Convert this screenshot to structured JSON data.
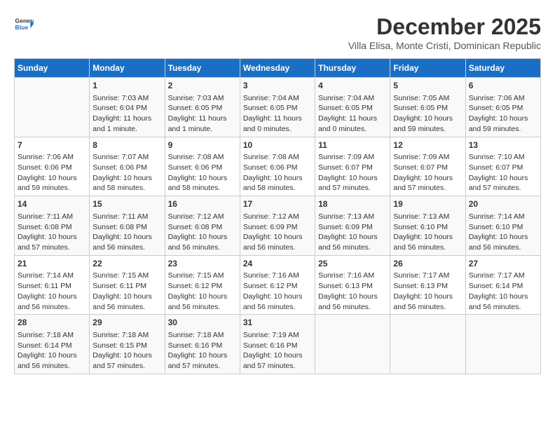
{
  "header": {
    "logo_line1": "General",
    "logo_line2": "Blue",
    "month": "December 2025",
    "location": "Villa Elisa, Monte Cristi, Dominican Republic"
  },
  "weekdays": [
    "Sunday",
    "Monday",
    "Tuesday",
    "Wednesday",
    "Thursday",
    "Friday",
    "Saturday"
  ],
  "weeks": [
    [
      {
        "num": "",
        "lines": []
      },
      {
        "num": "1",
        "lines": [
          "Sunrise: 7:03 AM",
          "Sunset: 6:04 PM",
          "Daylight: 11 hours",
          "and 1 minute."
        ]
      },
      {
        "num": "2",
        "lines": [
          "Sunrise: 7:03 AM",
          "Sunset: 6:05 PM",
          "Daylight: 11 hours",
          "and 1 minute."
        ]
      },
      {
        "num": "3",
        "lines": [
          "Sunrise: 7:04 AM",
          "Sunset: 6:05 PM",
          "Daylight: 11 hours",
          "and 0 minutes."
        ]
      },
      {
        "num": "4",
        "lines": [
          "Sunrise: 7:04 AM",
          "Sunset: 6:05 PM",
          "Daylight: 11 hours",
          "and 0 minutes."
        ]
      },
      {
        "num": "5",
        "lines": [
          "Sunrise: 7:05 AM",
          "Sunset: 6:05 PM",
          "Daylight: 10 hours",
          "and 59 minutes."
        ]
      },
      {
        "num": "6",
        "lines": [
          "Sunrise: 7:06 AM",
          "Sunset: 6:05 PM",
          "Daylight: 10 hours",
          "and 59 minutes."
        ]
      }
    ],
    [
      {
        "num": "7",
        "lines": [
          "Sunrise: 7:06 AM",
          "Sunset: 6:06 PM",
          "Daylight: 10 hours",
          "and 59 minutes."
        ]
      },
      {
        "num": "8",
        "lines": [
          "Sunrise: 7:07 AM",
          "Sunset: 6:06 PM",
          "Daylight: 10 hours",
          "and 58 minutes."
        ]
      },
      {
        "num": "9",
        "lines": [
          "Sunrise: 7:08 AM",
          "Sunset: 6:06 PM",
          "Daylight: 10 hours",
          "and 58 minutes."
        ]
      },
      {
        "num": "10",
        "lines": [
          "Sunrise: 7:08 AM",
          "Sunset: 6:06 PM",
          "Daylight: 10 hours",
          "and 58 minutes."
        ]
      },
      {
        "num": "11",
        "lines": [
          "Sunrise: 7:09 AM",
          "Sunset: 6:07 PM",
          "Daylight: 10 hours",
          "and 57 minutes."
        ]
      },
      {
        "num": "12",
        "lines": [
          "Sunrise: 7:09 AM",
          "Sunset: 6:07 PM",
          "Daylight: 10 hours",
          "and 57 minutes."
        ]
      },
      {
        "num": "13",
        "lines": [
          "Sunrise: 7:10 AM",
          "Sunset: 6:07 PM",
          "Daylight: 10 hours",
          "and 57 minutes."
        ]
      }
    ],
    [
      {
        "num": "14",
        "lines": [
          "Sunrise: 7:11 AM",
          "Sunset: 6:08 PM",
          "Daylight: 10 hours",
          "and 57 minutes."
        ]
      },
      {
        "num": "15",
        "lines": [
          "Sunrise: 7:11 AM",
          "Sunset: 6:08 PM",
          "Daylight: 10 hours",
          "and 56 minutes."
        ]
      },
      {
        "num": "16",
        "lines": [
          "Sunrise: 7:12 AM",
          "Sunset: 6:08 PM",
          "Daylight: 10 hours",
          "and 56 minutes."
        ]
      },
      {
        "num": "17",
        "lines": [
          "Sunrise: 7:12 AM",
          "Sunset: 6:09 PM",
          "Daylight: 10 hours",
          "and 56 minutes."
        ]
      },
      {
        "num": "18",
        "lines": [
          "Sunrise: 7:13 AM",
          "Sunset: 6:09 PM",
          "Daylight: 10 hours",
          "and 56 minutes."
        ]
      },
      {
        "num": "19",
        "lines": [
          "Sunrise: 7:13 AM",
          "Sunset: 6:10 PM",
          "Daylight: 10 hours",
          "and 56 minutes."
        ]
      },
      {
        "num": "20",
        "lines": [
          "Sunrise: 7:14 AM",
          "Sunset: 6:10 PM",
          "Daylight: 10 hours",
          "and 56 minutes."
        ]
      }
    ],
    [
      {
        "num": "21",
        "lines": [
          "Sunrise: 7:14 AM",
          "Sunset: 6:11 PM",
          "Daylight: 10 hours",
          "and 56 minutes."
        ]
      },
      {
        "num": "22",
        "lines": [
          "Sunrise: 7:15 AM",
          "Sunset: 6:11 PM",
          "Daylight: 10 hours",
          "and 56 minutes."
        ]
      },
      {
        "num": "23",
        "lines": [
          "Sunrise: 7:15 AM",
          "Sunset: 6:12 PM",
          "Daylight: 10 hours",
          "and 56 minutes."
        ]
      },
      {
        "num": "24",
        "lines": [
          "Sunrise: 7:16 AM",
          "Sunset: 6:12 PM",
          "Daylight: 10 hours",
          "and 56 minutes."
        ]
      },
      {
        "num": "25",
        "lines": [
          "Sunrise: 7:16 AM",
          "Sunset: 6:13 PM",
          "Daylight: 10 hours",
          "and 56 minutes."
        ]
      },
      {
        "num": "26",
        "lines": [
          "Sunrise: 7:17 AM",
          "Sunset: 6:13 PM",
          "Daylight: 10 hours",
          "and 56 minutes."
        ]
      },
      {
        "num": "27",
        "lines": [
          "Sunrise: 7:17 AM",
          "Sunset: 6:14 PM",
          "Daylight: 10 hours",
          "and 56 minutes."
        ]
      }
    ],
    [
      {
        "num": "28",
        "lines": [
          "Sunrise: 7:18 AM",
          "Sunset: 6:14 PM",
          "Daylight: 10 hours",
          "and 56 minutes."
        ]
      },
      {
        "num": "29",
        "lines": [
          "Sunrise: 7:18 AM",
          "Sunset: 6:15 PM",
          "Daylight: 10 hours",
          "and 57 minutes."
        ]
      },
      {
        "num": "30",
        "lines": [
          "Sunrise: 7:18 AM",
          "Sunset: 6:16 PM",
          "Daylight: 10 hours",
          "and 57 minutes."
        ]
      },
      {
        "num": "31",
        "lines": [
          "Sunrise: 7:19 AM",
          "Sunset: 6:16 PM",
          "Daylight: 10 hours",
          "and 57 minutes."
        ]
      },
      {
        "num": "",
        "lines": []
      },
      {
        "num": "",
        "lines": []
      },
      {
        "num": "",
        "lines": []
      }
    ]
  ]
}
